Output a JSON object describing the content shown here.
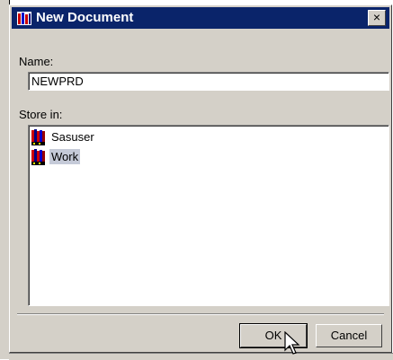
{
  "window": {
    "title": "New Document",
    "close_glyph": "×",
    "icon": "sas-library-icon"
  },
  "form": {
    "name_label": "Name:",
    "name_value": "NEWPRD",
    "store_label": "Store in:"
  },
  "libraries": [
    {
      "label": "Sasuser",
      "icon": "library-books-icon",
      "selected": false
    },
    {
      "label": "Work",
      "icon": "library-books-icon",
      "selected": true
    }
  ],
  "buttons": {
    "ok_label": "OK",
    "cancel_label": "Cancel"
  },
  "colors": {
    "titlebar": "#0a246a",
    "dialog_face": "#d4d0c8",
    "selection": "#c5cad8"
  }
}
